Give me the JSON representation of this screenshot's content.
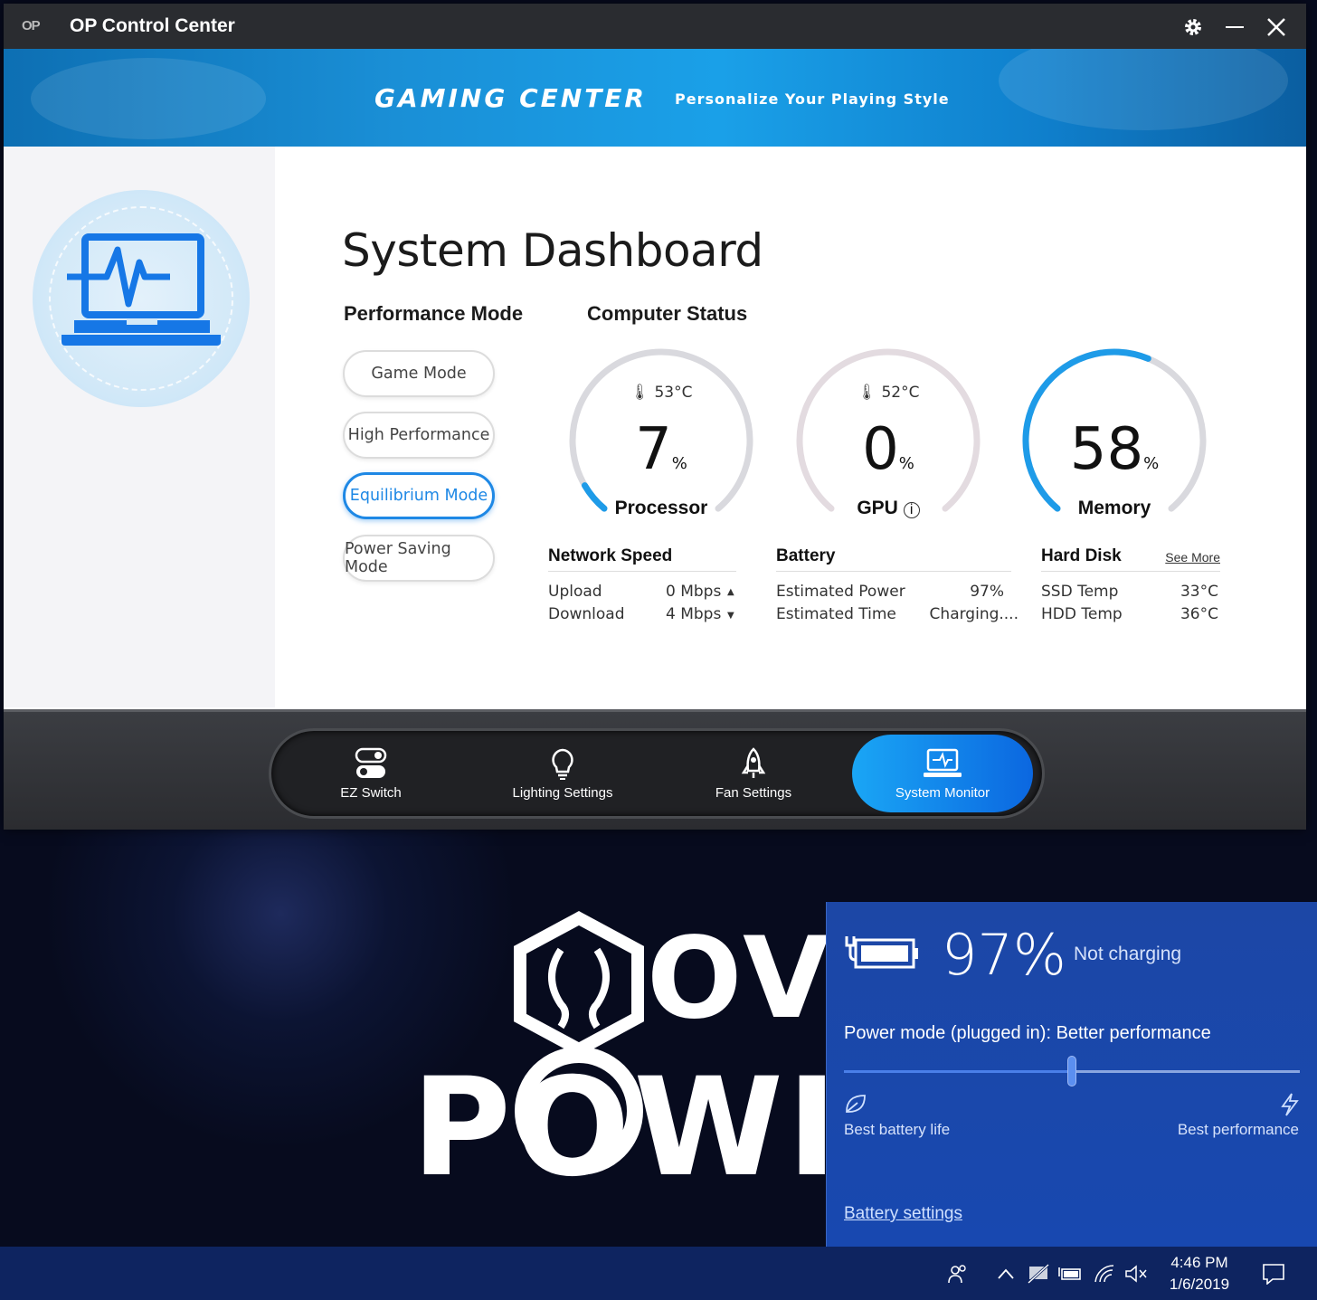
{
  "window": {
    "logo": "OP",
    "title": "OP Control Center",
    "banner_title": "GAMING CENTER",
    "banner_subtitle": "Personalize Your Playing Style"
  },
  "dashboard": {
    "title": "System Dashboard",
    "performance_heading": "Performance Mode",
    "modes": [
      "Game Mode",
      "High Performance",
      "Equilibrium Mode",
      "Power Saving Mode"
    ],
    "active_mode": "Equilibrium Mode",
    "status_heading": "Computer Status",
    "gauges": [
      {
        "label": "Processor",
        "temp": "53°C",
        "value": "7",
        "unit": "%",
        "level": 0.07
      },
      {
        "label": "GPU",
        "temp": "52°C",
        "value": "0",
        "unit": "%",
        "level": 0.0
      },
      {
        "label": "Memory",
        "temp": "",
        "value": "58",
        "unit": "%",
        "level": 0.58
      }
    ],
    "network": {
      "heading": "Network Speed",
      "upload_label": "Upload",
      "upload_value": "0 Mbps",
      "download_label": "Download",
      "download_value": "4 Mbps"
    },
    "battery": {
      "heading": "Battery",
      "power_label": "Estimated Power",
      "power_value": "97%",
      "time_label": "Estimated Time",
      "time_value": "Charging...."
    },
    "disk": {
      "heading": "Hard Disk",
      "see_more": "See More",
      "ssd_label": "SSD Temp",
      "ssd_value": "33°C",
      "hdd_label": "HDD Temp",
      "hdd_value": "36°C"
    }
  },
  "nav": {
    "items": [
      "EZ Switch",
      "Lighting Settings",
      "Fan Settings",
      "System Monitor"
    ],
    "active": "System Monitor"
  },
  "flyout": {
    "percent": "97%",
    "status": "Not charging",
    "power_mode": "Power mode (plugged in): Better performance",
    "slider_level": 0.5,
    "left_label": "Best battery life",
    "right_label": "Best performance",
    "link": "Battery settings"
  },
  "wallpaper": {
    "line1": "OVE",
    "line2": "POWI"
  },
  "taskbar": {
    "time": "4:46 PM",
    "date": "1/6/2019"
  },
  "colors": {
    "accent": "#1e88e5",
    "flyout_bg": "#1c47a6",
    "taskbar_bg": "#0e2460"
  }
}
